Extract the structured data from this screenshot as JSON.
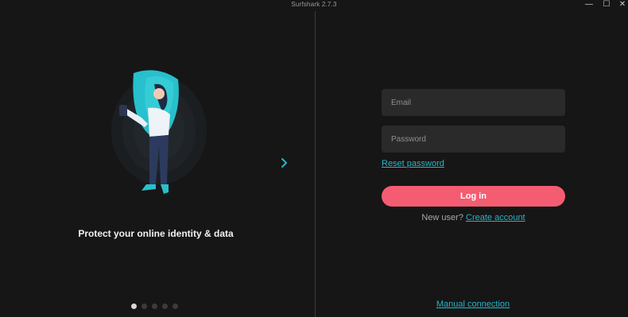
{
  "window": {
    "title": "Surfshark 2.7.3",
    "controls": {
      "minimize": "—",
      "maximize": "☐",
      "close": "✕"
    }
  },
  "slideshow": {
    "caption": "Protect your online identity & data",
    "slide_count": 5,
    "active_index": 0
  },
  "login": {
    "email_placeholder": "Email",
    "password_placeholder": "Password",
    "reset_password": "Reset password",
    "login_button": "Log in",
    "new_user_text": "New user?",
    "create_account": "Create account",
    "manual_connection": "Manual connection"
  },
  "colors": {
    "background": "#161616",
    "field_bg": "#2a2a2a",
    "accent_link": "#27b4c8",
    "login_button": "#f45c72",
    "illustration_teal": "#27c0cc"
  },
  "icons": {
    "next": "chevron-right-icon"
  }
}
